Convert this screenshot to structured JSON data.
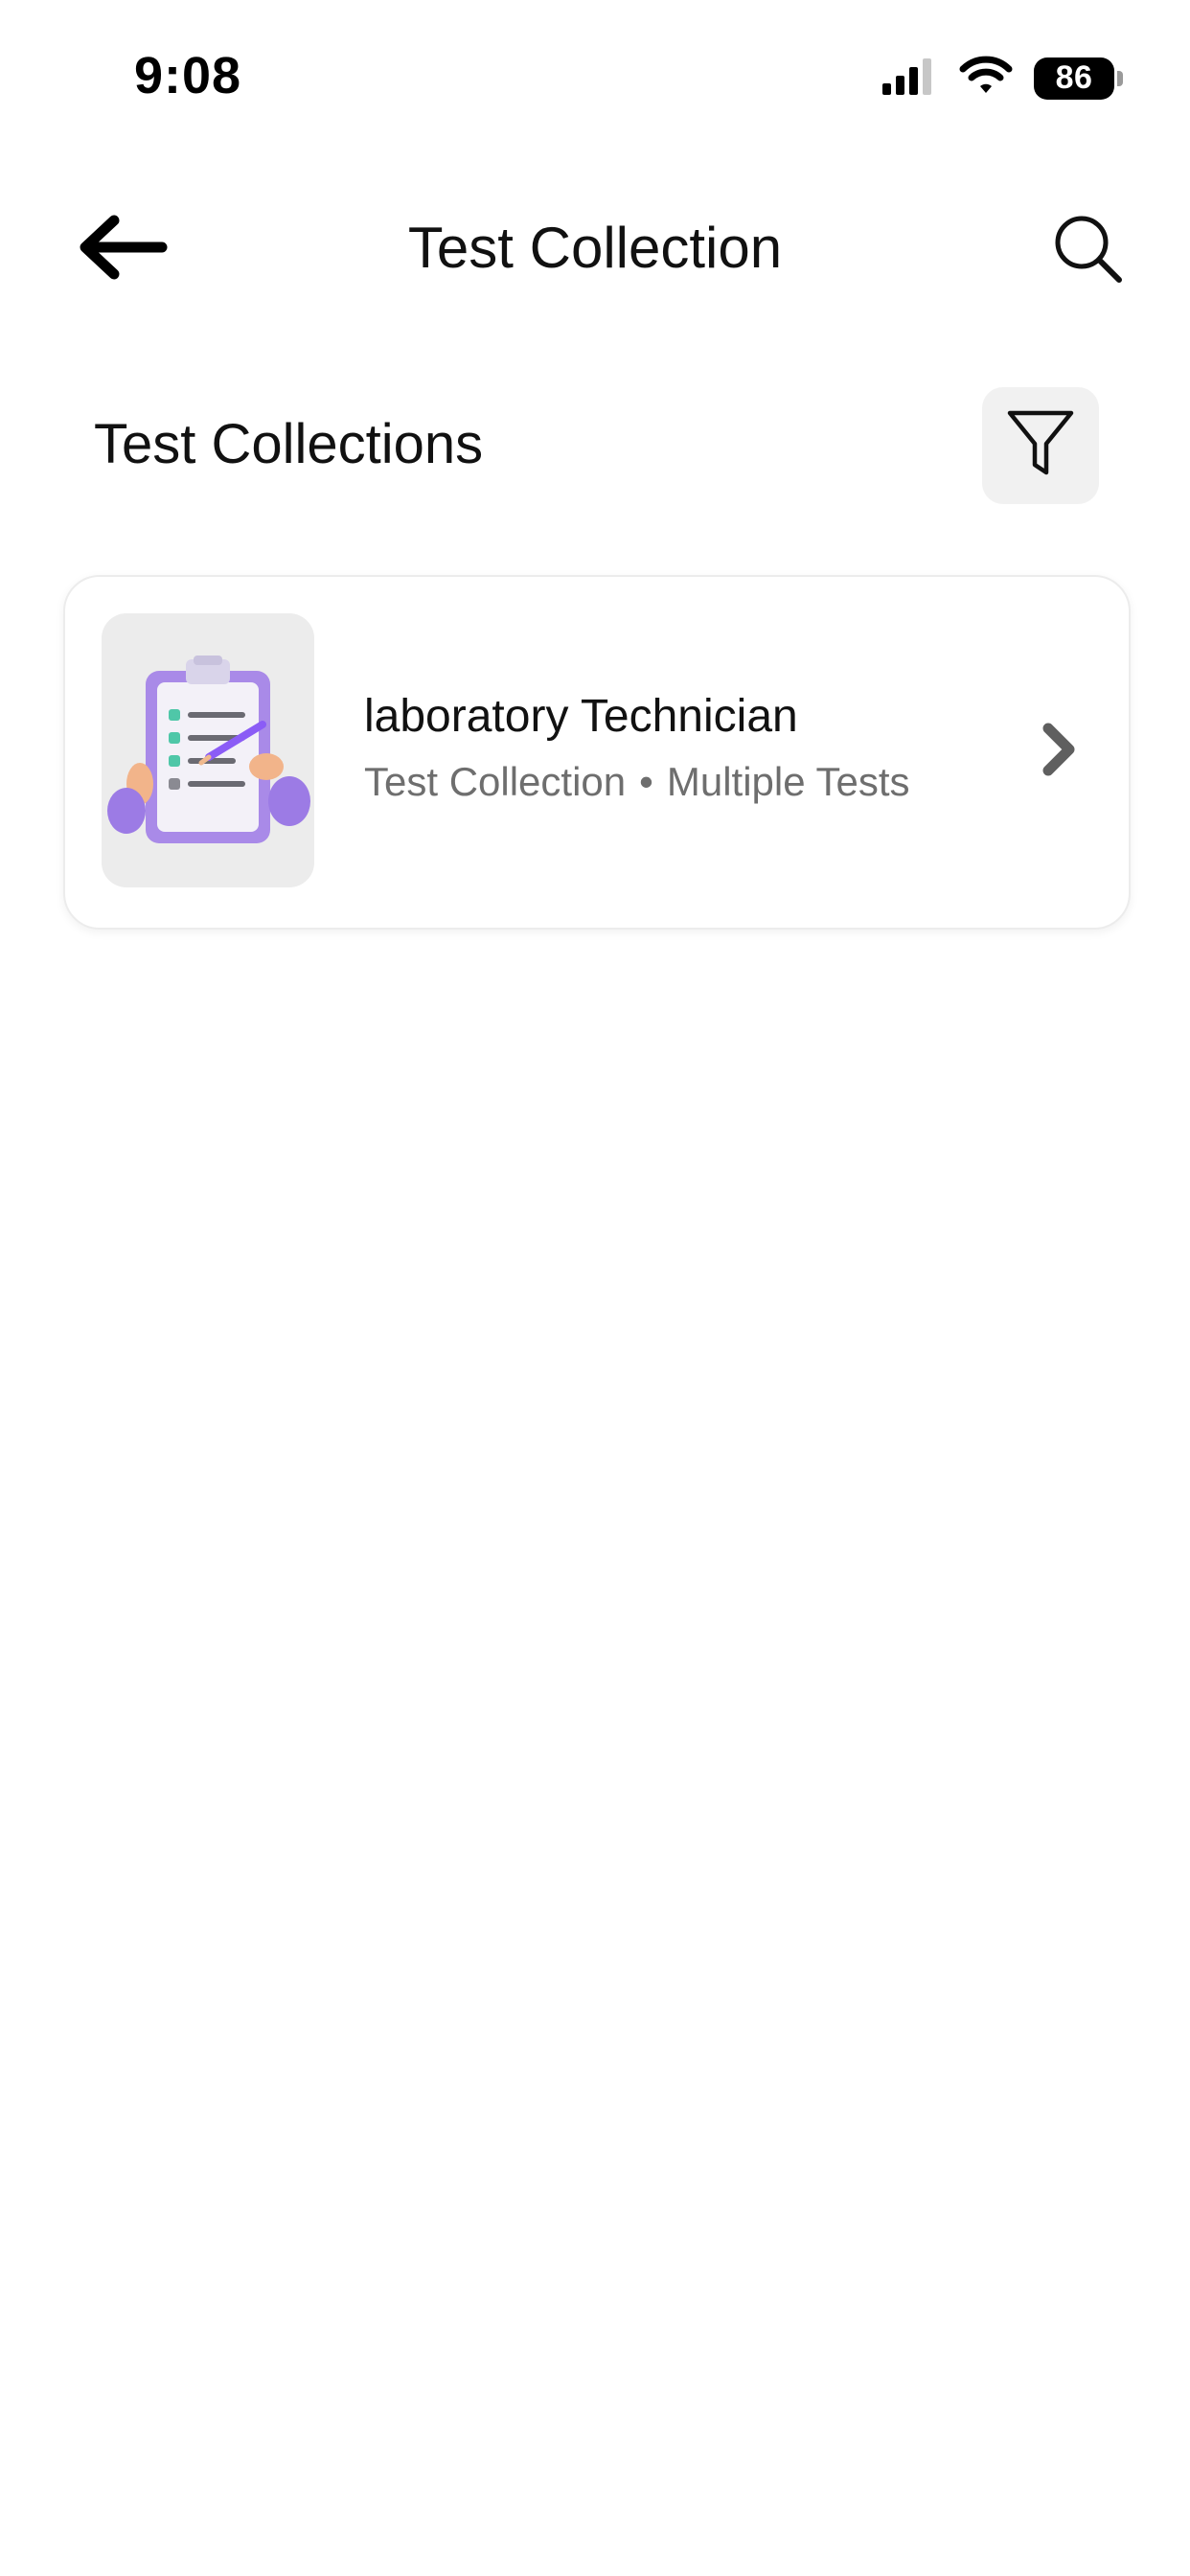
{
  "status_bar": {
    "time": "9:08",
    "battery_level": "86",
    "icons": [
      "cellular-signal-icon",
      "wifi-icon",
      "battery-icon"
    ]
  },
  "header": {
    "title": "Test Collection",
    "back_icon": "arrow-left-icon",
    "search_icon": "search-icon"
  },
  "section": {
    "title": "Test Collections",
    "filter_icon": "filter-icon"
  },
  "collections": [
    {
      "title": "laboratory Technician",
      "type": "Test Collection",
      "separator": "•",
      "detail": "Multiple Tests",
      "thumbnail_icon": "clipboard-checklist-illustration",
      "chevron_icon": "chevron-right-icon"
    }
  ],
  "colors": {
    "background": "#ffffff",
    "text_primary": "#111111",
    "text_secondary": "#6e6e6e",
    "filter_bg": "#f1f1f1",
    "card_border": "#ececec",
    "accent_purple": "#9b7be6",
    "accent_teal": "#4fc7a8"
  }
}
